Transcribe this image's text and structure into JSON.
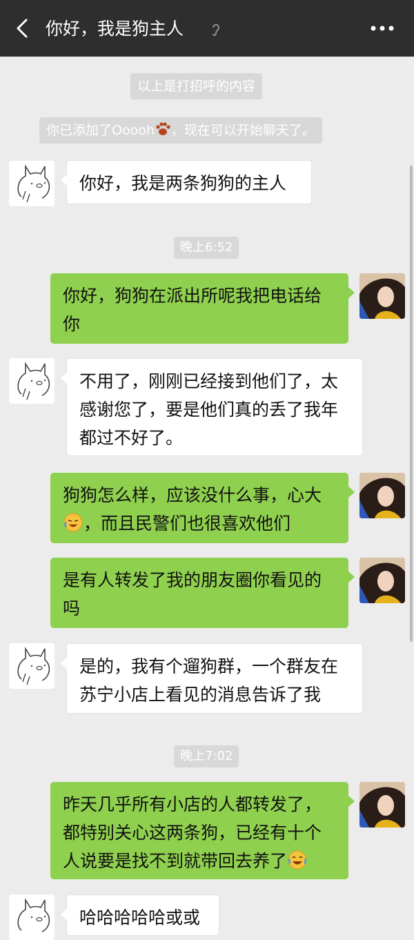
{
  "header": {
    "back_icon": "chevron-left-icon",
    "title": "你好，我是狗主人",
    "ear_icon": "ear-icon",
    "more_icon": "more-dots-icon"
  },
  "system": {
    "greeting_note": "以上是打招呼的内容",
    "added_prefix": "你已添加了Ooooh",
    "added_suffix": "，现在可以开始聊天了。",
    "paw_icon": "paw-emoji"
  },
  "times": [
    "晚上6:52",
    "晚上7:02"
  ],
  "messages": [
    {
      "side": "in",
      "text": "你好，我是两条狗狗的主人"
    },
    {
      "side": "out",
      "text": "你好，狗狗在派出所呢我把电话给你"
    },
    {
      "side": "in",
      "text": "不用了，刚刚已经接到他们了，太感谢您了，要是他们真的丢了我年都过不好了。"
    },
    {
      "side": "out",
      "text_before": "狗狗怎么样，应该没什么事，心大",
      "emoji": "crying-laughing-emoji",
      "text_after": "，而且民警们也很喜欢他们"
    },
    {
      "side": "out",
      "text": "是有人转发了我的朋友圈你看见的吗"
    },
    {
      "side": "in",
      "text": "是的，我有个遛狗群，一个群友在苏宁小店上看见的消息告诉了我"
    },
    {
      "side": "out",
      "text_before": "昨天几乎所有小店的人都转发了，都特别关心这两条狗，已经有十个人说要是找不到就带回去养了",
      "emoji": "tears-of-joy-emoji"
    },
    {
      "side": "in",
      "text": "哈哈哈哈哈或或"
    }
  ],
  "colors": {
    "header_bg": "#2e2e2e",
    "chat_bg": "#ececec",
    "out_bubble": "#8fd04e",
    "in_bubble": "#ffffff",
    "system_pill": "#d8d8d8"
  }
}
